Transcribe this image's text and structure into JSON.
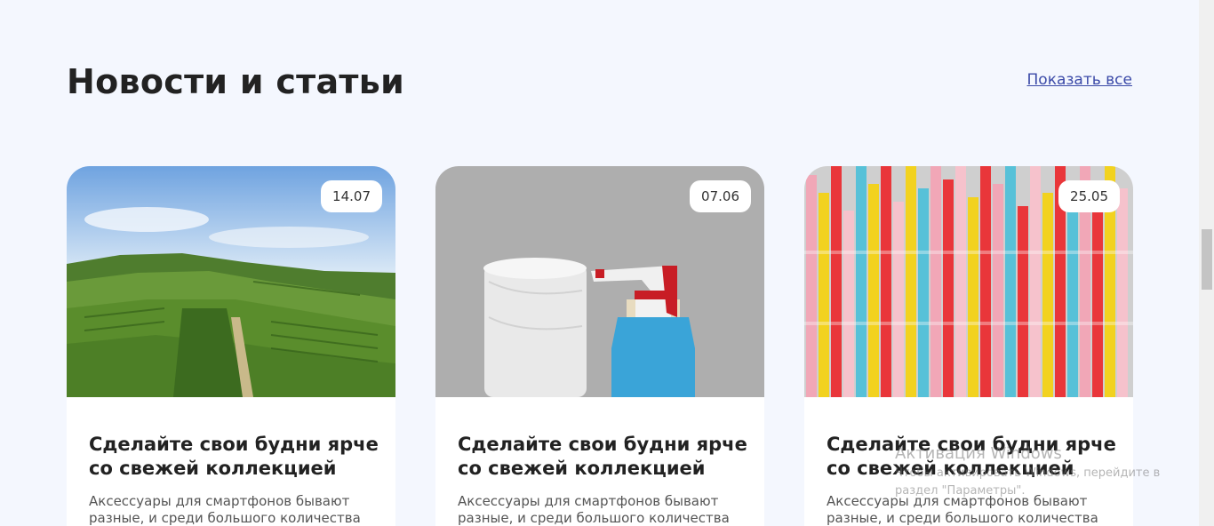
{
  "section": {
    "title": "Новости и статьи",
    "show_all_label": "Показать все"
  },
  "cards": [
    {
      "date": "14.07",
      "title": "Сделайте свои будни ярче со свежей коллекцией",
      "text": "Аксессуары для смартфонов бывают разные, и среди большого количества",
      "image": "vineyard-hills-photo"
    },
    {
      "date": "07.06",
      "title": "Сделайте свои будни ярче со свежей коллекцией",
      "text": "Аксессуары для смартфонов бывают разные, и среди большого количества",
      "image": "paper-towel-spray-bottle-photo"
    },
    {
      "date": "25.05",
      "title": "Сделайте свои будни ярче со свежей коллекцией",
      "text": "Аксессуары для смартфонов бывают разные, и среди большого количества",
      "image": "drinking-straws-photo"
    }
  ],
  "watermark": {
    "title": "Активация Windows",
    "subtitle": "Чтобы активировать Windows, перейдите в раздел \"Параметры\"."
  },
  "colors": {
    "background": "#f4f7fe",
    "link": "#3b4aa8",
    "title": "#222222"
  }
}
